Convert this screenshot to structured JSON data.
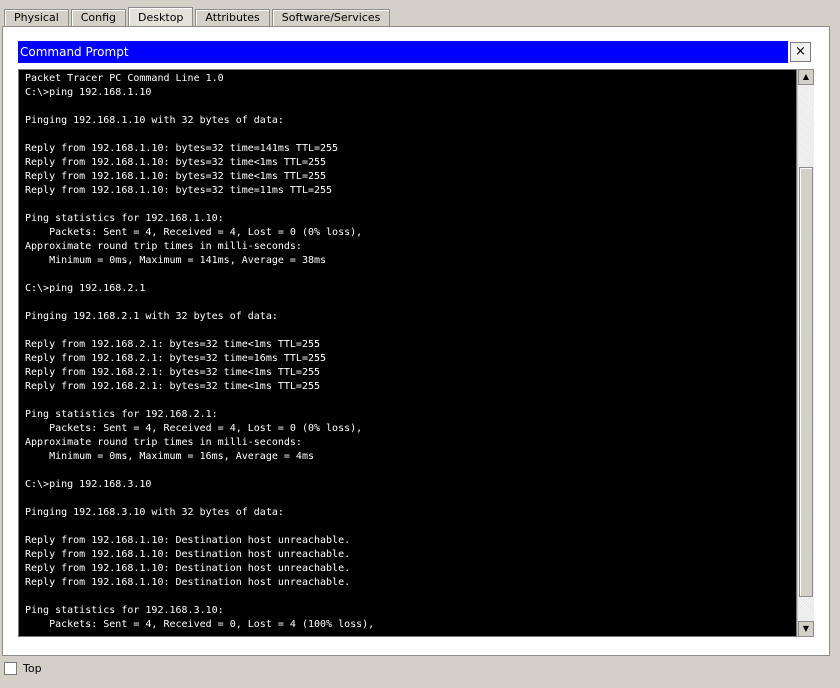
{
  "tabs": [
    {
      "label": "Physical",
      "active": false
    },
    {
      "label": "Config",
      "active": false
    },
    {
      "label": "Desktop",
      "active": true
    },
    {
      "label": "Attributes",
      "active": false
    },
    {
      "label": "Software/Services",
      "active": false
    }
  ],
  "window": {
    "title": "Command Prompt",
    "close_glyph": "×"
  },
  "console": {
    "text": "Packet Tracer PC Command Line 1.0\nC:\\>ping 192.168.1.10\n\nPinging 192.168.1.10 with 32 bytes of data:\n\nReply from 192.168.1.10: bytes=32 time=141ms TTL=255\nReply from 192.168.1.10: bytes=32 time<1ms TTL=255\nReply from 192.168.1.10: bytes=32 time<1ms TTL=255\nReply from 192.168.1.10: bytes=32 time=11ms TTL=255\n\nPing statistics for 192.168.1.10:\n    Packets: Sent = 4, Received = 4, Lost = 0 (0% loss),\nApproximate round trip times in milli-seconds:\n    Minimum = 0ms, Maximum = 141ms, Average = 38ms\n\nC:\\>ping 192.168.2.1\n\nPinging 192.168.2.1 with 32 bytes of data:\n\nReply from 192.168.2.1: bytes=32 time<1ms TTL=255\nReply from 192.168.2.1: bytes=32 time=16ms TTL=255\nReply from 192.168.2.1: bytes=32 time<1ms TTL=255\nReply from 192.168.2.1: bytes=32 time<1ms TTL=255\n\nPing statistics for 192.168.2.1:\n    Packets: Sent = 4, Received = 4, Lost = 0 (0% loss),\nApproximate round trip times in milli-seconds:\n    Minimum = 0ms, Maximum = 16ms, Average = 4ms\n\nC:\\>ping 192.168.3.10\n\nPinging 192.168.3.10 with 32 bytes of data:\n\nReply from 192.168.1.10: Destination host unreachable.\nReply from 192.168.1.10: Destination host unreachable.\nReply from 192.168.1.10: Destination host unreachable.\nReply from 192.168.1.10: Destination host unreachable.\n\nPing statistics for 192.168.3.10:\n    Packets: Sent = 4, Received = 0, Lost = 4 (100% loss),"
  },
  "scrollbar": {
    "up_glyph": "▲",
    "down_glyph": "▼"
  },
  "bottom": {
    "top_checkbox_label": "Top",
    "top_checked": false
  },
  "colors": {
    "titlebar": "#0000ff",
    "console_bg": "#000000",
    "console_fg": "#ffffff"
  }
}
